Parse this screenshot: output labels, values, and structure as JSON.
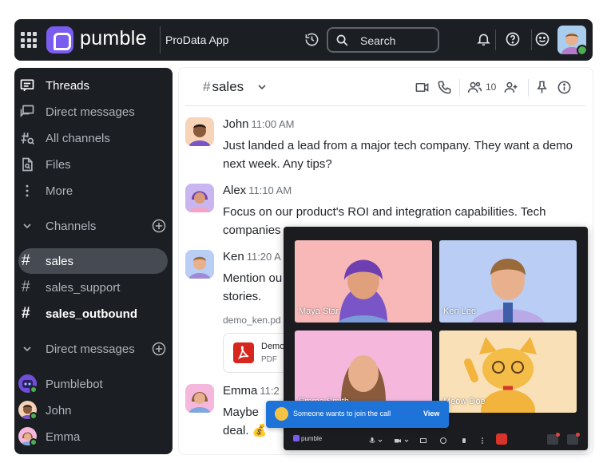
{
  "topbar": {
    "app_name": "pumble",
    "workspace": "ProData App",
    "search_placeholder": "Search"
  },
  "sidebar": {
    "nav": [
      {
        "label": "Threads",
        "icon": "threads-icon"
      },
      {
        "label": "Direct messages",
        "icon": "direct-messages-icon"
      },
      {
        "label": "All channels",
        "icon": "all-channels-icon"
      },
      {
        "label": "Files",
        "icon": "files-icon"
      },
      {
        "label": "More",
        "icon": "more-icon"
      }
    ],
    "channels_header": "Channels",
    "channels": [
      {
        "name": "sales",
        "selected": true
      },
      {
        "name": "sales_support"
      },
      {
        "name": "sales_outbound",
        "unread": true
      }
    ],
    "dm_header": "Direct messages",
    "dms": [
      {
        "name": "Pumblebot"
      },
      {
        "name": "John"
      },
      {
        "name": "Emma"
      }
    ]
  },
  "channel": {
    "name": "sales",
    "members": "10"
  },
  "messages": [
    {
      "author": "John",
      "time": "11:00 AM",
      "text": "Just landed a lead from a major tech company. They want a demo next week. Any tips?"
    },
    {
      "author": "Alex",
      "time": "11:10 AM",
      "text": "Focus on our product's ROI and integration capabilities. Tech companies"
    },
    {
      "author": "Ken",
      "time": "11:20 A",
      "text": "Mention ou",
      "text2": "stories."
    },
    {
      "author": "Emma",
      "time": "11:2",
      "text": "Maybe",
      "text2": "deal. 💰"
    }
  ],
  "attachment": {
    "label": "demo_ken.pd",
    "name": "Demo",
    "type": "PDF"
  },
  "call": {
    "logo": "pumble",
    "participants": [
      {
        "name": "Maya Star",
        "bg": "#f8b8b8"
      },
      {
        "name": "Ken Lee",
        "bg": "#b9cdf5"
      },
      {
        "name": "Emma Smith",
        "bg": "#f5b7dc"
      },
      {
        "name": "Meow Doe",
        "bg": "#f9e0b6"
      }
    ],
    "notification": "Someone wants to join the call",
    "view_label": "View"
  }
}
